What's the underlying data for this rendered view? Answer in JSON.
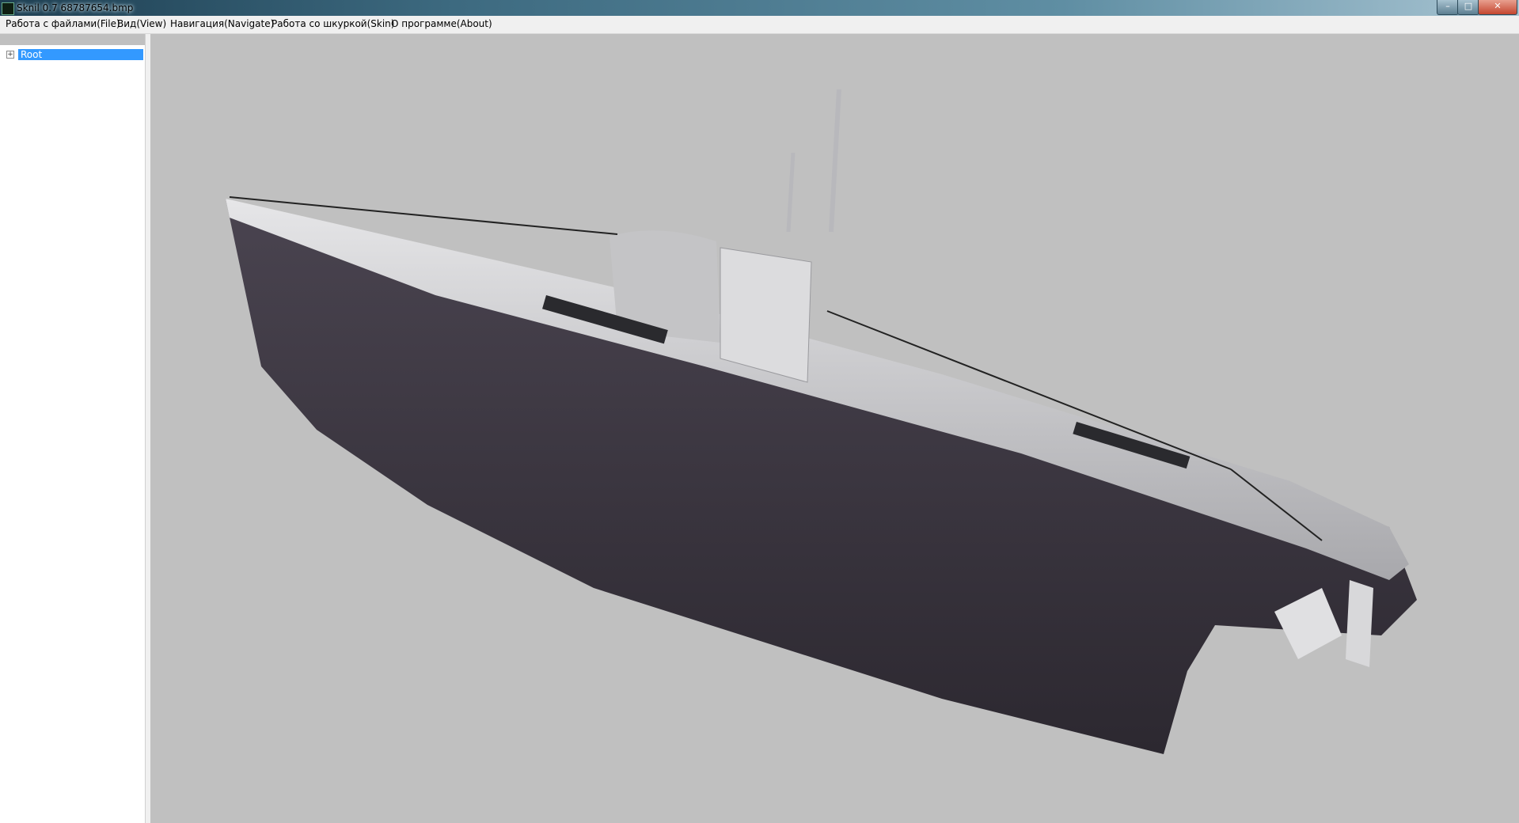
{
  "window": {
    "title": "Sknil 0.7   68787654.bmp",
    "controls": {
      "minimize": "–",
      "maximize": "□",
      "close": "✕"
    }
  },
  "menu": {
    "items": [
      "Работа с файлами(File)",
      "Вид(View)",
      "Навигация(Navigate)",
      "Работа со шкуркой(Skin)",
      "О программе(About)"
    ]
  },
  "tree": {
    "root_label": "Root",
    "root_expanded": false,
    "expander_glyph": "+"
  },
  "viewport": {
    "background": "#c0c0c0",
    "model": "submarine-3d-model",
    "hull_color": "#3b3540",
    "deck_color": "#d4d4d6"
  },
  "colors": {
    "titlebar": "#3d6a80",
    "menubar": "#f0f0f0",
    "selection": "#3399ff"
  }
}
